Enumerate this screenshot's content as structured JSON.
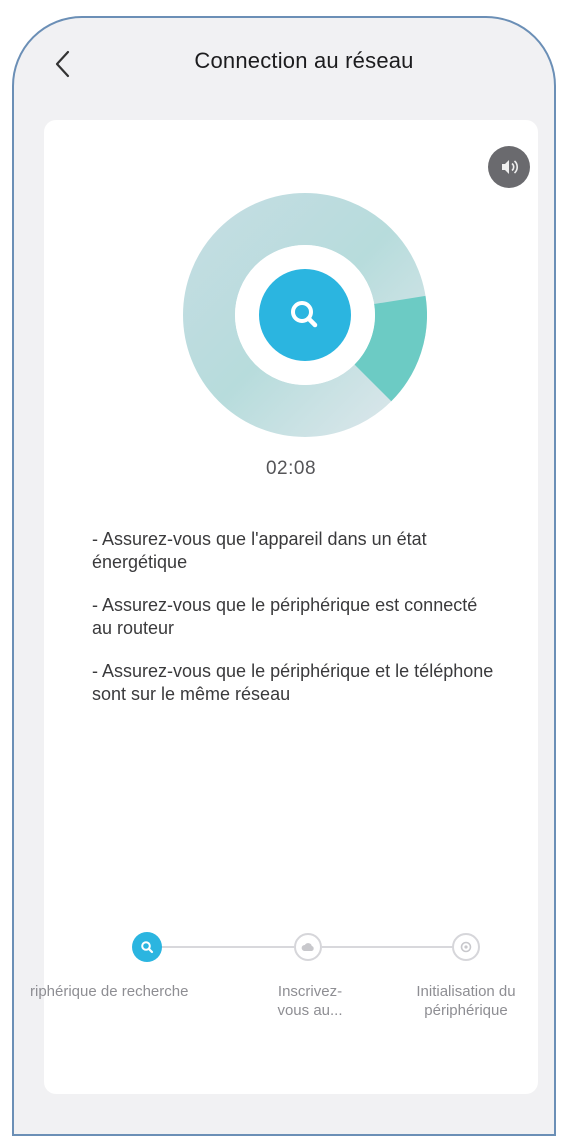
{
  "header": {
    "title": "Connection au réseau",
    "back_icon": "chevron-left-icon"
  },
  "card": {
    "sound_icon": "speaker-icon",
    "search_icon": "search-icon",
    "progress_fraction": 0.15,
    "timer": "02:08",
    "tips": [
      "- Assurez-vous que l'appareil dans un état énergétique",
      "- Assurez-vous que le périphérique est connecté au routeur",
      "- Assurez-vous que le périphérique et le téléphone sont sur le même réseau"
    ]
  },
  "steps": [
    {
      "label_line1": "riphérique de recherche",
      "label_line2": "",
      "icon": "search-icon",
      "state": "active"
    },
    {
      "label_line1": "Inscrivez-",
      "label_line2": "vous au...",
      "icon": "cloud-icon",
      "state": "inactive"
    },
    {
      "label_line1": "Initialisation du",
      "label_line2": "périphérique",
      "icon": "gear-icon",
      "state": "inactive"
    }
  ],
  "colors": {
    "accent": "#2bb5e0",
    "ring_base": "#cfe3e6",
    "ring_progress": "#6ccbc4",
    "background": "#f1f1f3",
    "frame": "#6b8fb6"
  }
}
